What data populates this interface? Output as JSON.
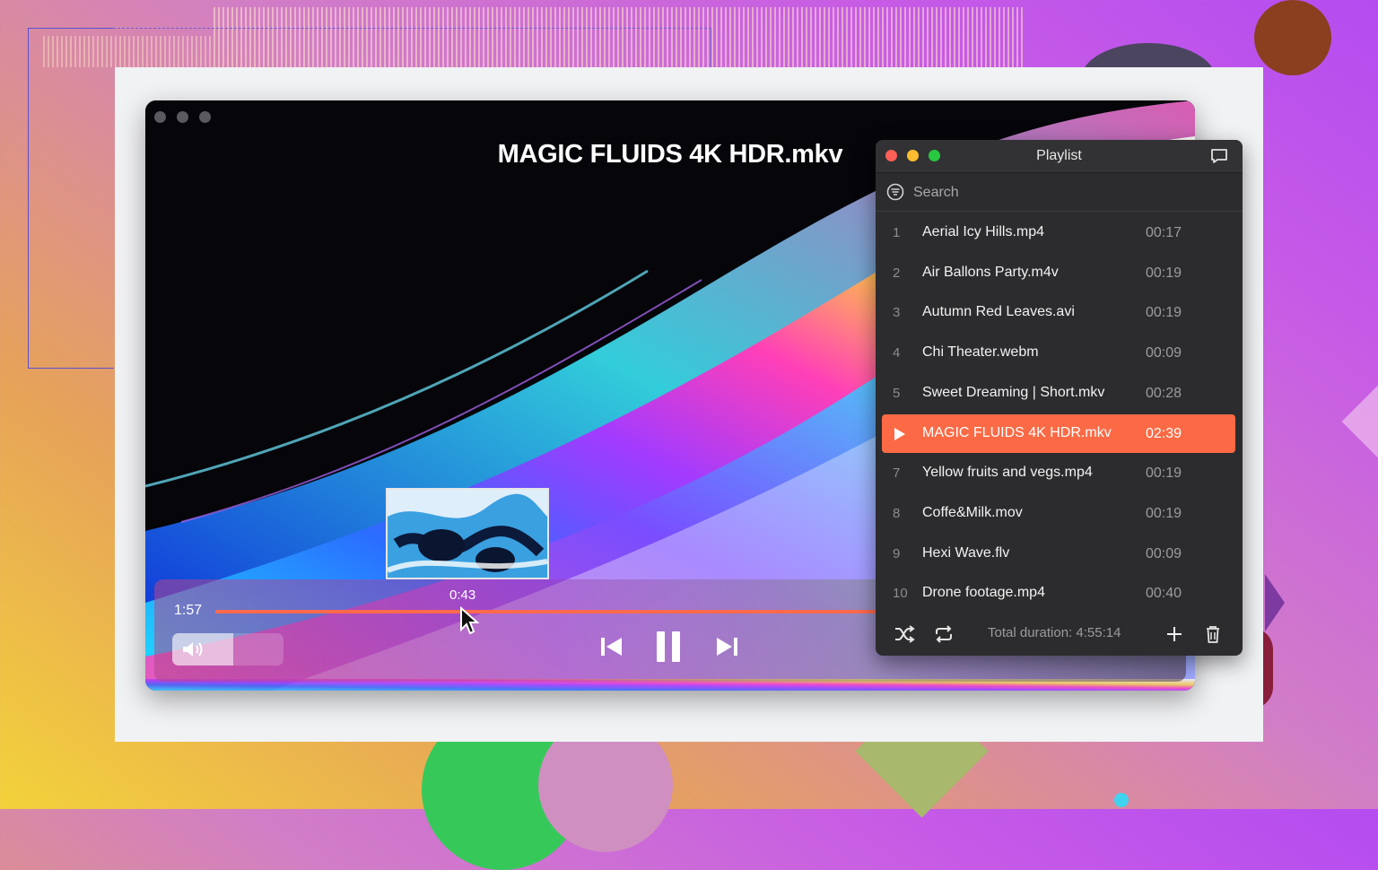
{
  "player": {
    "title": "MAGIC FLUIDS 4K HDR.mkv",
    "current_time": "1:57",
    "hover_time": "0:43",
    "progress": 1.0,
    "volume": 0.55
  },
  "playlist": {
    "title": "Playlist",
    "search_placeholder": "Search",
    "items": [
      {
        "num": "1",
        "name": "Aerial Icy Hills.mp4",
        "duration": "00:17"
      },
      {
        "num": "2",
        "name": "Air Ballons Party.m4v",
        "duration": "00:19"
      },
      {
        "num": "3",
        "name": "Autumn Red Leaves.avi",
        "duration": "00:19"
      },
      {
        "num": "4",
        "name": "Chi Theater.webm",
        "duration": "00:09"
      },
      {
        "num": "5",
        "name": "Sweet Dreaming | Short.mkv",
        "duration": "00:28"
      },
      {
        "num": "6",
        "name": "MAGIC FLUIDS 4K HDR.mkv",
        "duration": "02:39",
        "active": true
      },
      {
        "num": "7",
        "name": "Yellow fruits and vegs.mp4",
        "duration": "00:19"
      },
      {
        "num": "8",
        "name": "Coffe&Milk.mov",
        "duration": "00:19"
      },
      {
        "num": "9",
        "name": "Hexi Wave.flv",
        "duration": "00:09"
      },
      {
        "num": "10",
        "name": "Drone footage.mp4",
        "duration": "00:40"
      }
    ],
    "total_duration": "Total duration: 4:55:14"
  },
  "colors": {
    "accent": "#fb6a45",
    "panel_bg": "#2c2c2e",
    "close": "#fe5f57",
    "minimize": "#febc2e",
    "zoom": "#28c840"
  },
  "icons": [
    "volume-icon",
    "previous-icon",
    "pause-icon",
    "next-icon",
    "shuffle-icon",
    "repeat-icon",
    "add-icon",
    "trash-icon",
    "filter-icon",
    "chat-icon",
    "play-icon",
    "cursor-icon"
  ]
}
